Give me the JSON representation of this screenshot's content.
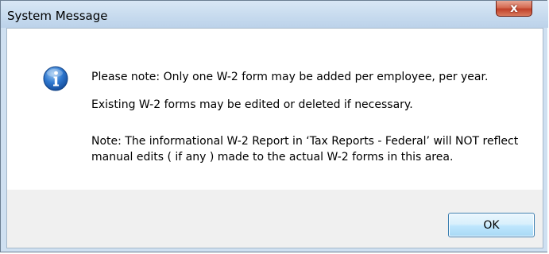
{
  "window": {
    "title": "System Message",
    "close_glyph": "x"
  },
  "message": {
    "icon": "info-icon",
    "lines": [
      "Please note: Only one W-2 form may be added per employee, per year.",
      "Existing W-2 forms may be edited or deleted if necessary.",
      "Note: The informational W-2 Report in ‘Tax Reports - Federal’ will NOT reflect manual edits ( if any ) made to the actual W-2 forms in this area."
    ]
  },
  "buttons": {
    "ok_label": "OK"
  },
  "colors": {
    "titlebar": "#c6daee",
    "close_button": "#c0412a",
    "info_icon": "#1d64b8",
    "ok_border": "#3c7fb1"
  }
}
